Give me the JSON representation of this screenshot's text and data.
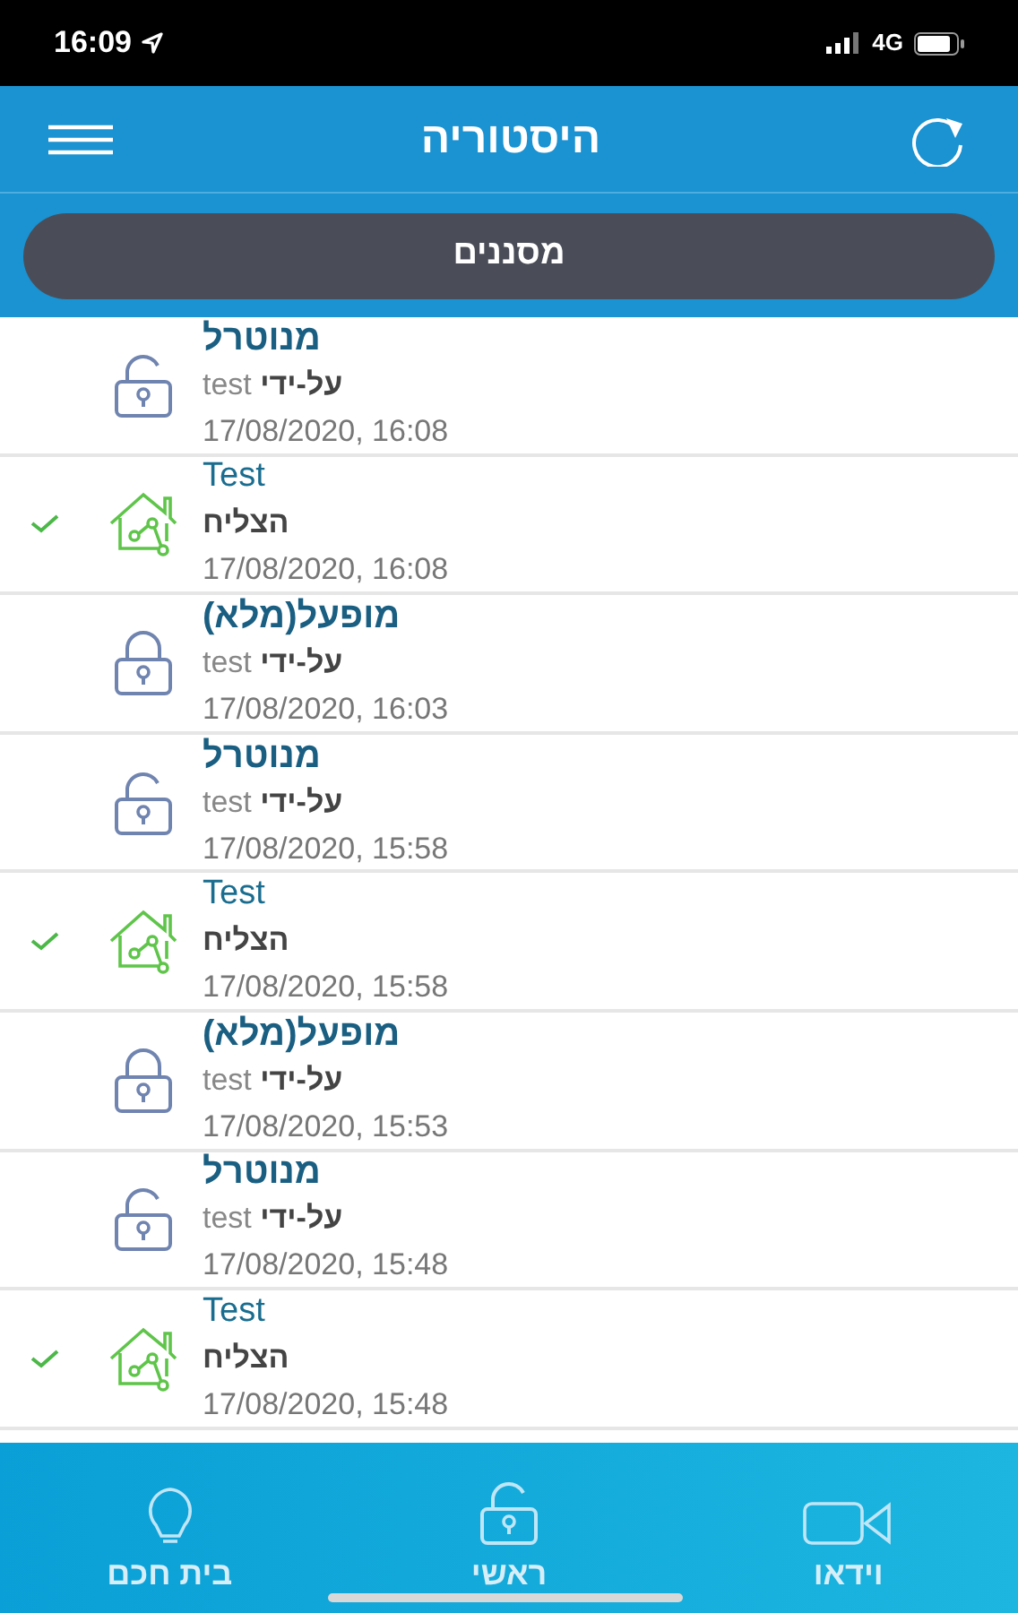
{
  "status_bar": {
    "time": "16:09",
    "network": "4G"
  },
  "header": {
    "title": "היסטוריה"
  },
  "filter_button": {
    "label": "מסננים"
  },
  "history": [
    {
      "kind": "lock",
      "locked": false,
      "title": "מנוטרל",
      "detail": "**על-ידי** test",
      "time": "17/08/2020, 16:08"
    },
    {
      "kind": "scene",
      "success": true,
      "title": "Test",
      "detail": "הצליח",
      "time": "17/08/2020, 16:08"
    },
    {
      "kind": "lock",
      "locked": true,
      "title": "(מופעל(מלא",
      "detail": "**על-ידי** test",
      "time": "17/08/2020, 16:03"
    },
    {
      "kind": "lock",
      "locked": false,
      "title": "מנוטרל",
      "detail": "**על-ידי** test",
      "time": "17/08/2020, 15:58"
    },
    {
      "kind": "scene",
      "success": true,
      "title": "Test",
      "detail": "הצליח",
      "time": "17/08/2020, 15:58"
    },
    {
      "kind": "lock",
      "locked": true,
      "title": "(מופעל(מלא",
      "detail": "**על-ידי** test",
      "time": "17/08/2020, 15:53"
    },
    {
      "kind": "lock",
      "locked": false,
      "title": "מנוטרל",
      "detail": "**על-ידי** test",
      "time": "17/08/2020, 15:48"
    },
    {
      "kind": "scene",
      "success": true,
      "title": "Test",
      "detail": "הצליח",
      "time": "17/08/2020, 15:48"
    }
  ],
  "tab_bar": [
    {
      "kind": "video",
      "label": "וידאו"
    },
    {
      "kind": "lock",
      "label": "ראשי"
    },
    {
      "kind": "bulb",
      "label": "בית חכם"
    }
  ]
}
